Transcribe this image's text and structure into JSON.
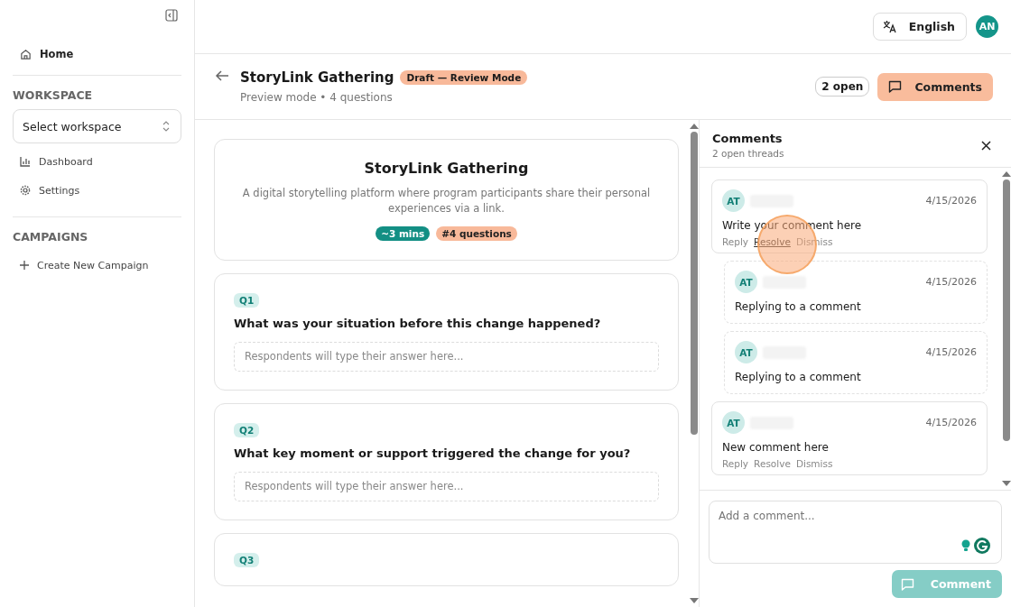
{
  "sidebar": {
    "home": "Home",
    "workspace_heading": "WORKSPACE",
    "workspace_select": "Select workspace",
    "items": [
      {
        "label": "Dashboard"
      },
      {
        "label": "Settings"
      }
    ],
    "campaigns_heading": "CAMPAIGNS",
    "create_campaign": "Create New Campaign"
  },
  "topbar": {
    "language": "English",
    "avatar": "AN"
  },
  "page_header": {
    "title": "StoryLink Gathering",
    "status_badge": "Draft — Review Mode",
    "subtitle": "Preview mode • 4 questions",
    "open_count": "2 open",
    "comments_button": "Comments"
  },
  "survey": {
    "title": "StoryLink Gathering",
    "description": "A digital storytelling platform where program participants share their personal experiences via a link.",
    "duration": "~3 mins",
    "question_count": "#4 questions",
    "questions": [
      {
        "badge": "Q1",
        "text": "What was your situation before this change happened?",
        "placeholder": "Respondents will type their answer here..."
      },
      {
        "badge": "Q2",
        "text": "What key moment or support triggered the change for you?",
        "placeholder": "Respondents will type their answer here..."
      },
      {
        "badge": "Q3"
      }
    ]
  },
  "comments_panel": {
    "title": "Comments",
    "subtitle": "2 open threads",
    "threads": [
      {
        "avatar": "AT",
        "date": "4/15/2026",
        "text": "Write your comment here",
        "actions": [
          {
            "label": "Reply",
            "hovered": false
          },
          {
            "label": "Resolve",
            "hovered": true
          },
          {
            "label": "Dismiss",
            "hovered": false
          }
        ],
        "replies": [
          {
            "avatar": "AT",
            "date": "4/15/2026",
            "text": "Replying to a comment"
          },
          {
            "avatar": "AT",
            "date": "4/15/2026",
            "text": "Replying to a comment"
          }
        ]
      },
      {
        "avatar": "AT",
        "date": "4/15/2026",
        "text": "New comment here",
        "actions": [
          {
            "label": "Reply",
            "hovered": false
          },
          {
            "label": "Resolve",
            "hovered": false
          },
          {
            "label": "Dismiss",
            "hovered": false
          }
        ]
      }
    ],
    "input_placeholder": "Add a comment...",
    "submit": {
      "label": "Comment",
      "disabled": true
    }
  }
}
